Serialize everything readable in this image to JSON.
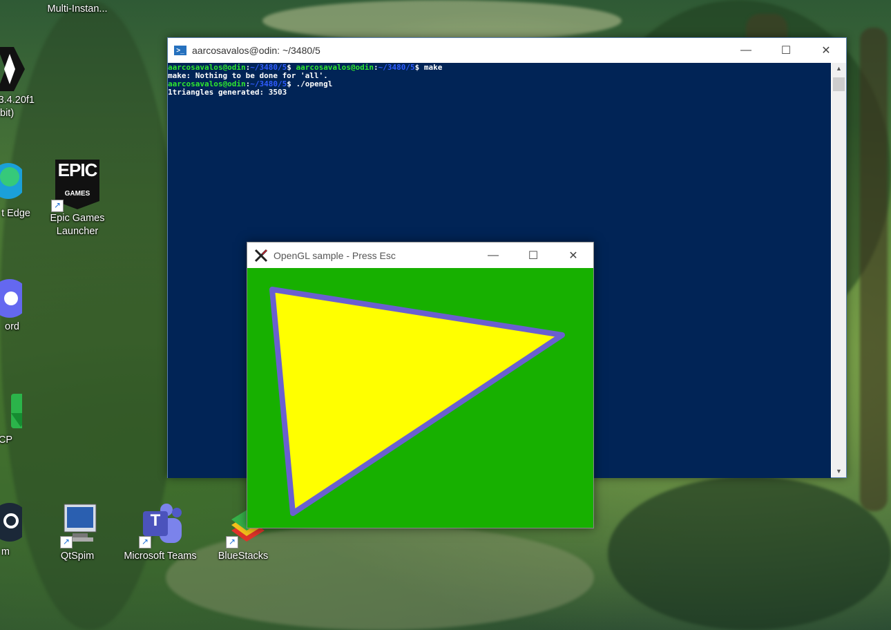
{
  "desktop": {
    "icons": [
      {
        "label": "Multi-Instan..."
      },
      {
        "label": "3.4.20f1"
      },
      {
        "label": "bit)"
      },
      {
        "label": "t Edge"
      },
      {
        "label": "Epic Games Launcher"
      },
      {
        "label": "ord"
      },
      {
        "label": "CP"
      },
      {
        "label": "m"
      },
      {
        "label": "QtSpim"
      },
      {
        "label": "Microsoft Teams"
      },
      {
        "label": "BlueStacks"
      }
    ],
    "epic_logo_text": "EPIC",
    "epic_logo_sub": "GAMES",
    "teams_letter": "T"
  },
  "terminal": {
    "title": "aarcosavalos@odin: ~/3480/5",
    "prompt_user": "aarcosavalos@odin",
    "prompt_path": "~/3480/5",
    "line1_cmd": "$ ",
    "line1_cmd2": "$ make",
    "line2": "make: Nothing to be done for 'all'.",
    "line3_cmd": "$ ./opengl",
    "line4": "1triangles generated: 3503",
    "colors": {
      "background": "#012456",
      "user": "#2fe82f",
      "path": "#2f5cff"
    }
  },
  "opengl_window": {
    "title": "OpenGL sample  -  Press Esc",
    "colors": {
      "background": "#17b000",
      "fill": "#ffff00",
      "outline": "#6a5fd0"
    }
  },
  "window_controls": {
    "minimize": "—",
    "maximize": "☐",
    "close": "✕"
  }
}
